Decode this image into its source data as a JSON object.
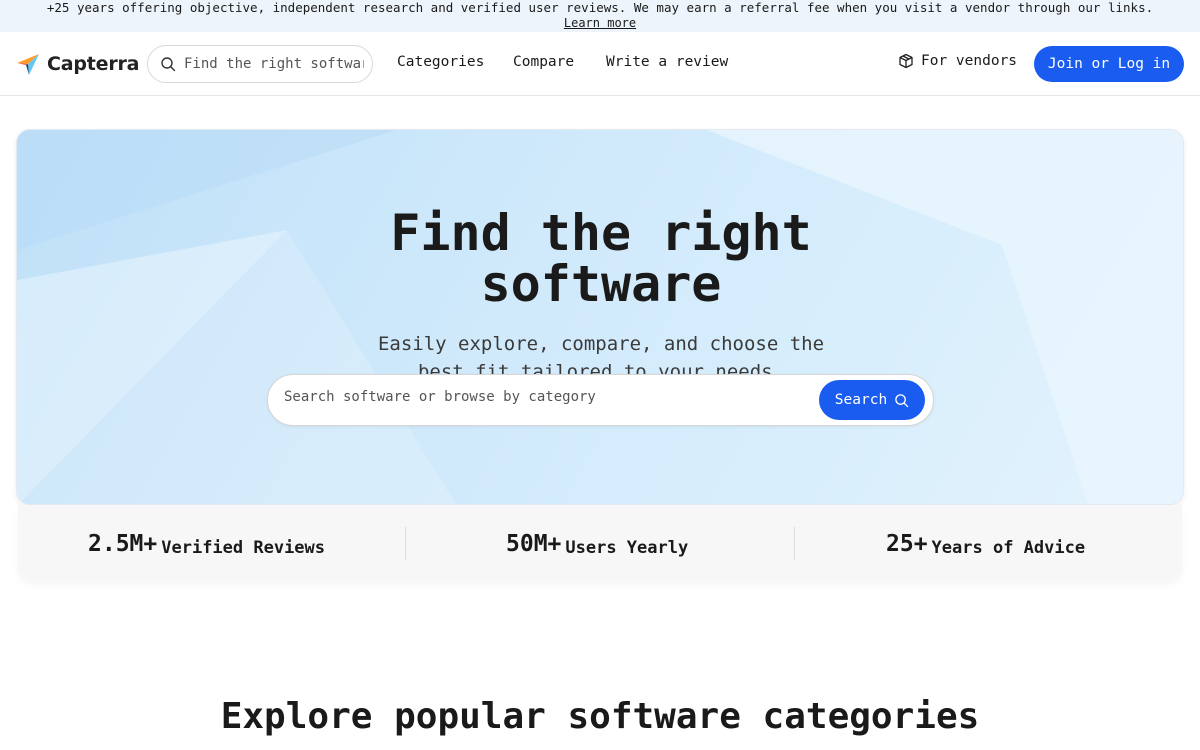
{
  "banner": {
    "text": "+25 years offering objective, independent research and verified user reviews. We may earn a referral fee when you visit a vendor through our links.",
    "link": "Learn more"
  },
  "nav": {
    "logo_text": "Capterra",
    "search_placeholder": "Find the right software",
    "links": [
      "Categories",
      "Compare",
      "Write a review"
    ],
    "vendors_label": "For vendors",
    "join_label": "Join or Log in",
    "accent_color": "#1a5cf0"
  },
  "hero": {
    "title": "Find the right software",
    "subtitle": "Easily explore, compare, and choose the best fit tailored to your needs.",
    "search_placeholder": "Search software or browse by category",
    "search_button": "Search"
  },
  "stats": [
    {
      "number": "2.5M+",
      "label": "Verified Reviews"
    },
    {
      "number": "50M+",
      "label": "Users Yearly"
    },
    {
      "number": "25+",
      "label": "Years of Advice"
    }
  ],
  "section": {
    "title": "Explore popular software categories"
  }
}
